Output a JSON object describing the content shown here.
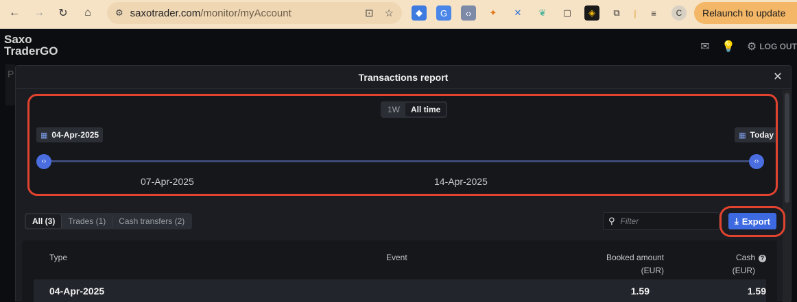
{
  "browser": {
    "url_host": "saxotrader.com",
    "url_path": "/monitor/myAccount",
    "relaunch_label": "Relaunch to update",
    "profile_initial": "C"
  },
  "app": {
    "logo_line1": "Saxo",
    "logo_line2": "TraderGO",
    "logout_label": "LOG OUT",
    "bg_tab_initial": "P"
  },
  "modal": {
    "title": "Transactions report",
    "period_options": [
      {
        "label": "1W",
        "active": false
      },
      {
        "label": "All time",
        "active": true
      }
    ],
    "start_date": "04-Apr-2025",
    "end_date": "Today",
    "slider_ticks": [
      "07-Apr-2025",
      "14-Apr-2025"
    ],
    "filter_tabs": [
      {
        "label": "All (3)",
        "active": true
      },
      {
        "label": "Trades (1)",
        "active": false
      },
      {
        "label": "Cash transfers (2)",
        "active": false
      }
    ],
    "search_placeholder": "Filter",
    "export_label": "Export",
    "table": {
      "headers": {
        "type": "Type",
        "event": "Event",
        "booked_line1": "Booked amount",
        "booked_line2": "(EUR)",
        "cash_line1": "Cash",
        "cash_line2": "(EUR)"
      },
      "rows": [
        {
          "type": "04-Apr-2025",
          "event": "",
          "booked": "1.59",
          "cash": "1.59"
        }
      ]
    }
  },
  "colors": {
    "accent": "#3e6ae1",
    "highlight": "#e2432f",
    "background": "#0c0d10"
  }
}
